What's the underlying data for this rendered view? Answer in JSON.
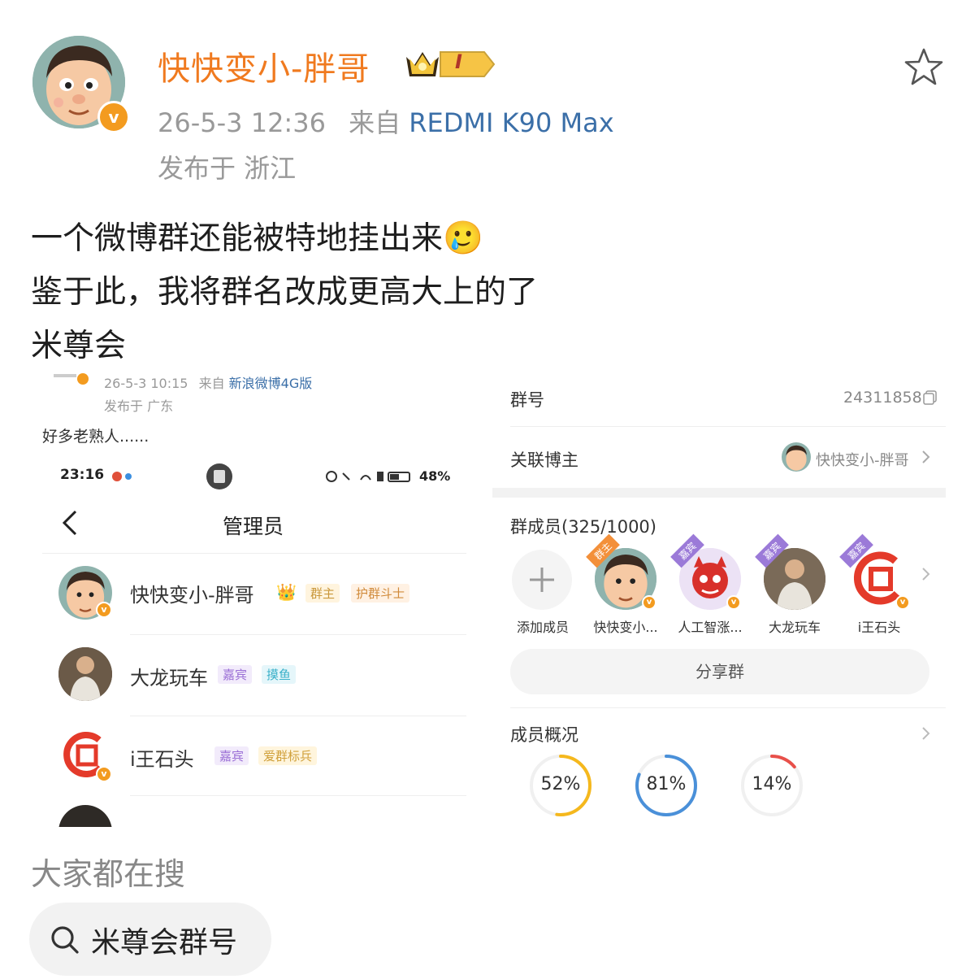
{
  "post": {
    "author": "快快变小-胖哥",
    "crown_level": "I",
    "time": "26-5-3 12:36",
    "from_prefix": "来自",
    "device": "REDMI K90 Max",
    "location": "发布于 浙江",
    "verified_mark": "v",
    "lines": [
      "一个微博群还能被特地挂出来",
      "鉴于此，我将群名改成更高大上的了",
      "米尊会"
    ],
    "emoji": "🥲"
  },
  "embedded": {
    "left": {
      "post_time": "26-5-3 10:15",
      "post_from": "来自",
      "post_device": "新浪微博4G版",
      "post_location": "发布于 广东",
      "post_text": "好多老熟人......",
      "status_time": "23:16",
      "battery": "48%",
      "nav_title": "管理员",
      "admins": [
        {
          "name": "快快变小-胖哥",
          "tags": [
            "群主",
            "护群斗士"
          ]
        },
        {
          "name": "大龙玩车",
          "tags": [
            "嘉宾",
            "摸鱼"
          ]
        },
        {
          "name": "i王石头",
          "tags": [
            "嘉宾",
            "爱群标兵"
          ]
        }
      ]
    },
    "right": {
      "group_id_label": "群号",
      "group_id": "24311858",
      "related_label": "关联博主",
      "related_name": "快快变小-胖哥",
      "members_title": "群成员(325/1000)",
      "add_label": "添加成员",
      "members": [
        "快快变小...",
        "人工智涨...",
        "大龙玩车",
        "i王石头"
      ],
      "member_badges": [
        "群主",
        "嘉宾",
        "嘉宾",
        "嘉宾"
      ],
      "share_label": "分享群",
      "overview_title": "成员概况",
      "rings": [
        {
          "label": "52%",
          "value": 52,
          "color": "#f5b81d"
        },
        {
          "label": "81%",
          "value": 81,
          "color": "#4a90d9"
        },
        {
          "label": "14%",
          "value": 14,
          "color": "#e8504a"
        }
      ]
    }
  },
  "search": {
    "title": "大家都在搜",
    "query": "米尊会群号"
  }
}
